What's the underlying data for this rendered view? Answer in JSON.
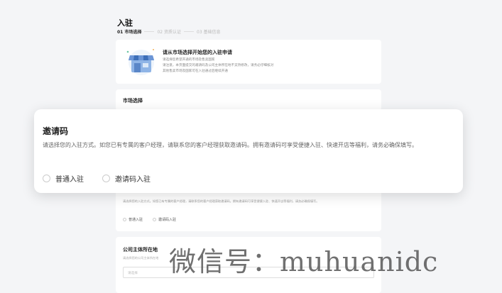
{
  "page": {
    "title": "入驻",
    "steps": [
      {
        "label": "01 市场选择",
        "active": true
      },
      {
        "label": "02 资质认证",
        "active": false
      },
      {
        "label": "03 基础信息",
        "active": false
      }
    ]
  },
  "intro": {
    "title": "请从市场选择开始您的入驻申请",
    "lines": [
      "请选择您希望开通的市场及售卖国家",
      "请注意，本页面提交的邀请码及公司主体所在地不支持修改，请务必仔细核对",
      "其他售卖市场及国家可在入驻通过后继续开通"
    ]
  },
  "market": {
    "title": "市场选择"
  },
  "invite_bg": {
    "desc": "请选择您的入驻方式。如您已有专属的客户经理，请联系您的客户经理获取邀请码。拥有邀请码可享受便捷入驻、快速开店等福利，请务必确保填写。",
    "options": [
      "普通入驻",
      "邀请码入驻"
    ]
  },
  "company": {
    "title": "公司主体所在地",
    "hint": "请选择您的公司主体所在地",
    "placeholder": "请选择"
  },
  "modal": {
    "title": "邀请码",
    "desc": "请选择您的入驻方式。如您已有专属的客户经理，请联系您的客户经理获取邀请码。拥有邀请码可享受便捷入驻、快速开店等福利，请务必确保填写。",
    "options": [
      "普通入驻",
      "邀请码入驻"
    ]
  },
  "watermark": "微信号：muhuanidc"
}
